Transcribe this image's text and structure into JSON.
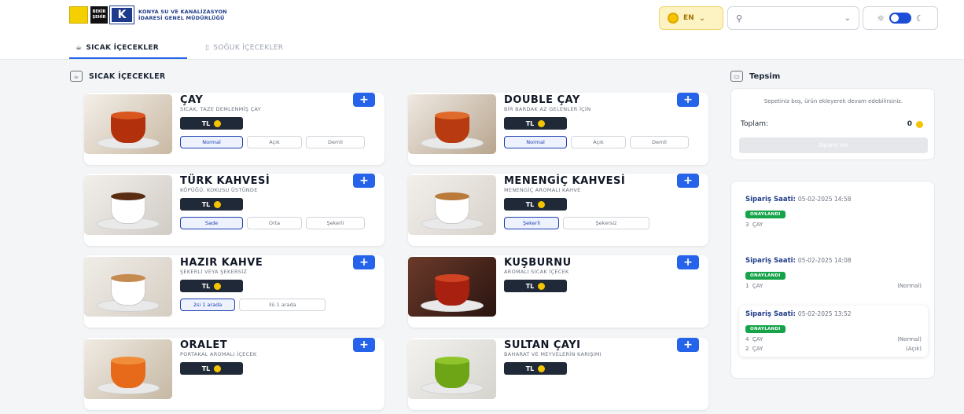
{
  "header": {
    "logo_text_line1": "KONYA SU VE KANALİZASYON",
    "logo_text_line2": "İDARESİ GENEL MÜDÜRLÜĞÜ",
    "logo_b_top": "BEKİR",
    "logo_b_bottom": "ŞEHİR",
    "logo_k": "K",
    "lang_code": "EN"
  },
  "tabs": [
    {
      "label": "SICAK İÇECEKLER"
    },
    {
      "label": "SOĞUK İÇECEKLER"
    }
  ],
  "section": {
    "title": "SICAK İÇECEKLER"
  },
  "currency": "TL",
  "products": [
    {
      "name": "ÇAY",
      "desc": "SICAK, TAZE DEMLENMİŞ ÇAY",
      "options": [
        "Normal",
        "Açık",
        "Demli"
      ],
      "selected": "Normal"
    },
    {
      "name": "DOUBLE ÇAY",
      "desc": "BİR BARDAK AZ GELENLER İÇİN",
      "options": [
        "Normal",
        "Açık",
        "Demli"
      ],
      "selected": "Normal"
    },
    {
      "name": "TÜRK KAHVESİ",
      "desc": "KÖPÜĞÜ, KOKUSU ÜSTÜNDE",
      "options": [
        "Sade",
        "Orta",
        "Şekerli"
      ],
      "selected": "Sade"
    },
    {
      "name": "MENENGİÇ KAHVESİ",
      "desc": "MENENGİÇ AROMALI KAHVE",
      "options": [
        "Şekerli",
        "Şekersiz"
      ],
      "selected": "Şekerli"
    },
    {
      "name": "HAZIR KAHVE",
      "desc": "ŞEKERLİ VEYA ŞEKERSİZ",
      "options": [
        "2si 1 arada",
        "3ü 1 arada"
      ],
      "selected": "2si 1 arada"
    },
    {
      "name": "KUŞBURNU",
      "desc": "AROMALI SICAK İÇECEK",
      "options": [],
      "selected": ""
    },
    {
      "name": "ORALET",
      "desc": "PORTAKAL AROMALI İÇECEK",
      "options": [],
      "selected": ""
    },
    {
      "name": "SULTAN ÇAYI",
      "desc": "BAHARAT VE MEYVELERİN KARIŞIMI",
      "options": [],
      "selected": ""
    }
  ],
  "cart": {
    "title": "Tepsim",
    "empty_text": "Sepetiniz boş, ürün ekleyerek devam edebilirsiniz.",
    "total_label": "Toplam:",
    "total_value": "0",
    "order_button": "Sipariş Ver"
  },
  "orders": {
    "label": "Sipariş Saati:",
    "badge": "ONAYLANDI",
    "items": [
      {
        "time": "05-02-2025 14:58",
        "lines": [
          {
            "qty": "3",
            "name": "ÇAY",
            "opt": ""
          }
        ]
      },
      {
        "time": "05-02-2025 14:08",
        "lines": [
          {
            "qty": "1",
            "name": "ÇAY",
            "opt": "(Normal)"
          }
        ]
      },
      {
        "time": "05-02-2025 13:52",
        "lines": [
          {
            "qty": "4",
            "name": "ÇAY",
            "opt": "(Normal)"
          },
          {
            "qty": "2",
            "name": "ÇAY",
            "opt": "(Açık)"
          }
        ]
      }
    ]
  },
  "colors": {
    "accent": "#2563eb",
    "dark": "#1f2937",
    "coin": "#f5c400",
    "approved": "#16a34a"
  }
}
